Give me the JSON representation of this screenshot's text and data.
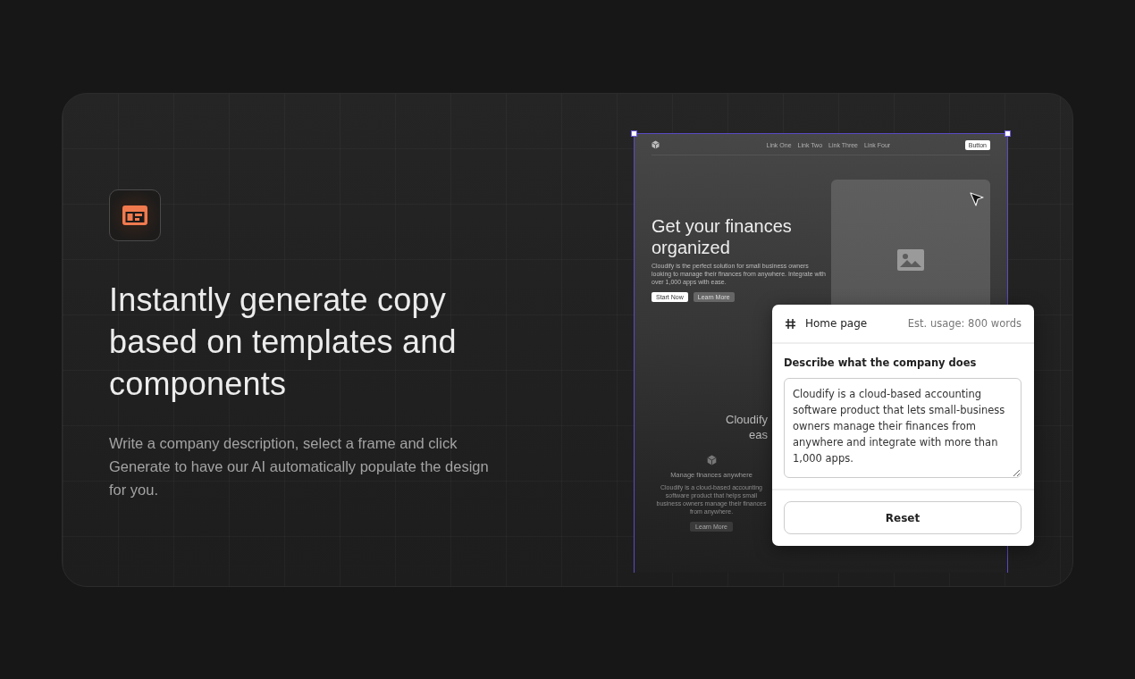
{
  "feature": {
    "title": "Instantly generate copy based on templates and components",
    "description": "Write a company description, select a frame and click Generate to have our AI automatically populate the design for you."
  },
  "mockup": {
    "selected": true,
    "nav_links": [
      "Link One",
      "Link Two",
      "Link Three",
      "Link Four"
    ],
    "nav_button": "Button",
    "hero_title": "Get your finances organized",
    "hero_text": "Cloudify is the perfect solution for small business owners looking to manage their finances from anywhere. Integrate with over 1,000 apps with ease.",
    "hero_buttons": [
      {
        "label": "Start Now",
        "kind": "primary"
      },
      {
        "label": "Learn More",
        "kind": "secondary"
      }
    ],
    "section_title_lines": [
      "Cloudify",
      "eas"
    ],
    "feature_title": "Manage finances anywhere",
    "feature_text": "Cloudify is a cloud-based accounting software product that helps small business owners manage their finances from anywhere.",
    "feature_button": "Learn More"
  },
  "panel": {
    "page": "Home page",
    "usage": "Est. usage: 800 words",
    "label": "Describe what the company does",
    "value": "Cloudify is a cloud-based accounting software product that lets small-business owners manage their finances from anywhere and integrate with more than 1,000 apps.",
    "button": "Reset"
  }
}
